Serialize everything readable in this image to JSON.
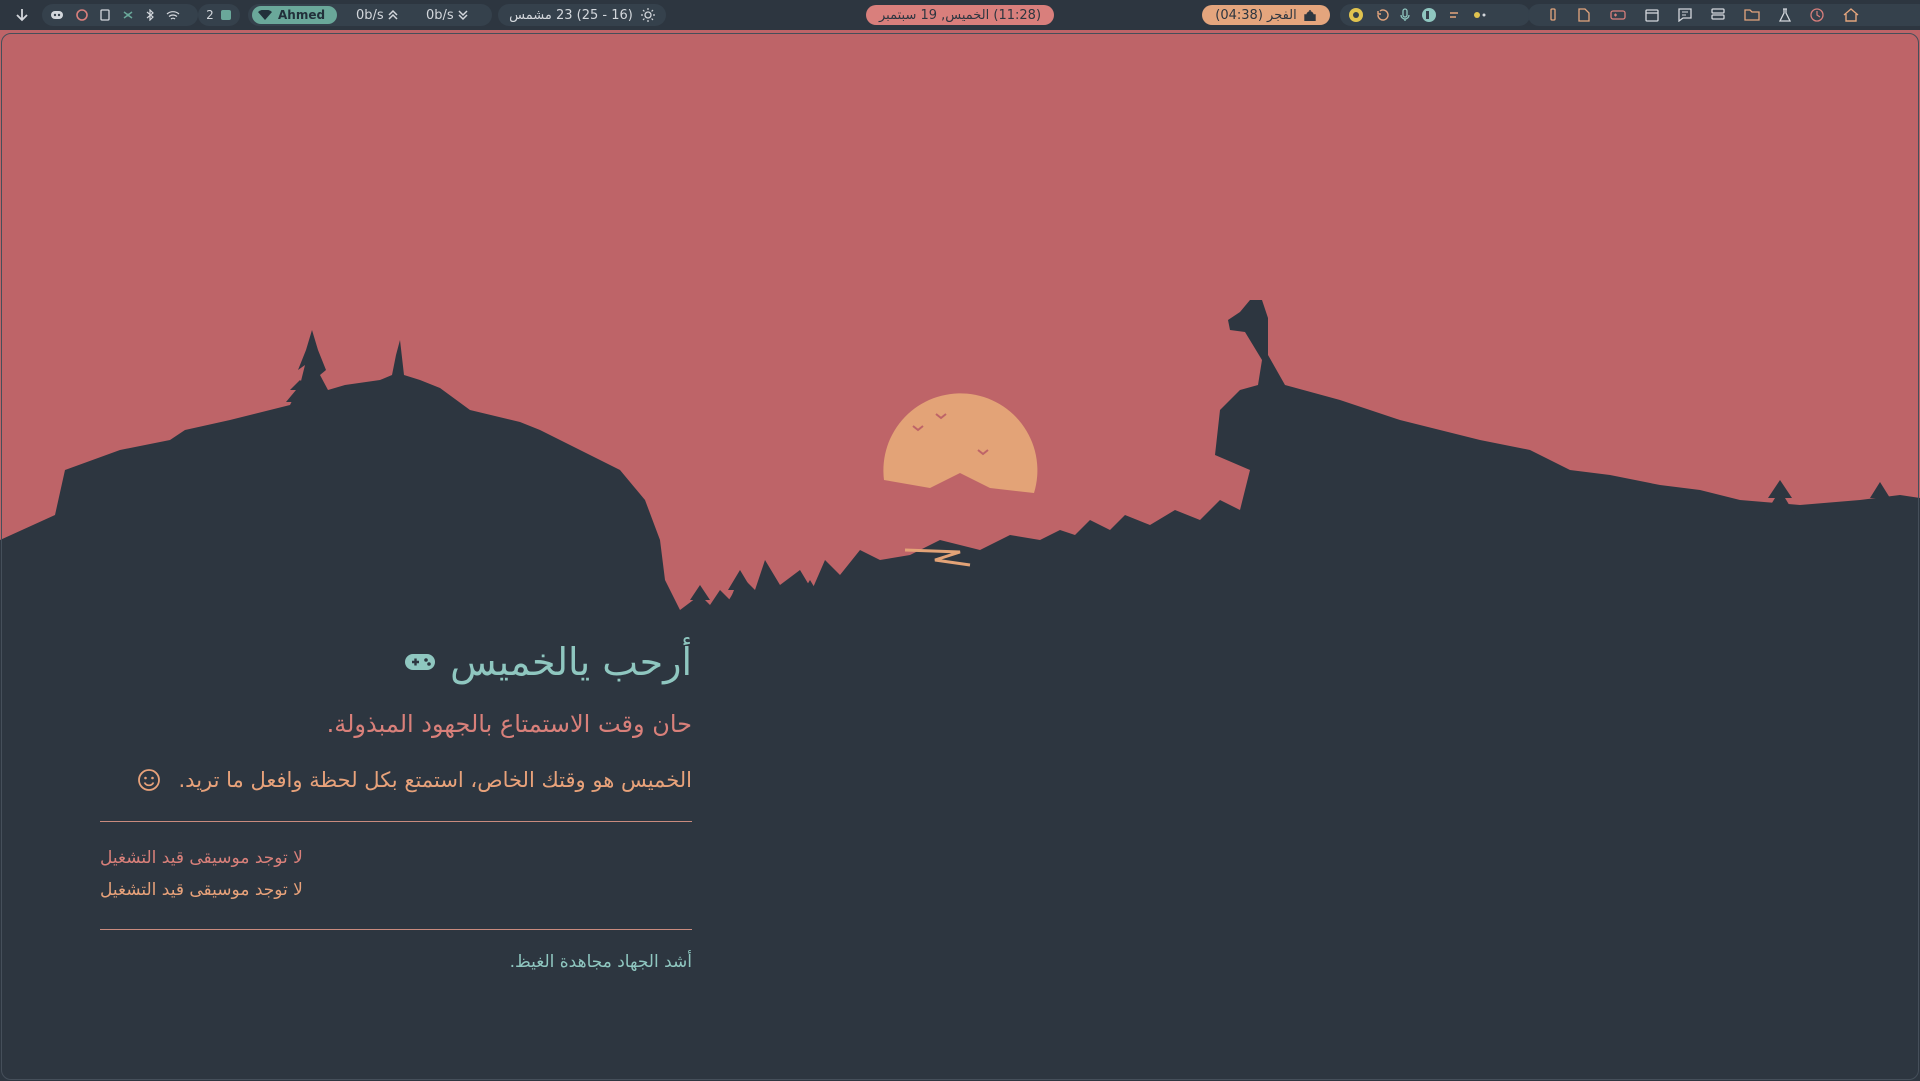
{
  "topbar": {
    "workspace_count": "2",
    "network_name": "Ahmed",
    "upload_speed": "0b/s",
    "download_speed": "0b/s",
    "weather": "(16 - 25) 23 مشمس",
    "datetime": "(11:28) الخميس, 19 سبتمبر",
    "prayer": "الفجر (04:38)",
    "colors": {
      "bar": "#2d3640",
      "segment": "#35414c",
      "green": "#6aa89a",
      "pink": "#d97f7c",
      "orange": "#e4a57d"
    }
  },
  "wallpaper": {
    "sky_color": "#be6468",
    "ground_color": "#2d3640",
    "sun_color": "#e3a377"
  },
  "greeting": {
    "title": "أرحب يالخميس",
    "subtitle": "حان وقت الاستمتاع بالجهود المبذولة.",
    "message": "الخميس هو وقتك الخاص، استمتع بكل لحظة وافعل ما تريد."
  },
  "music": {
    "line1": "لا توجد موسيقى قيد التشغيل",
    "line2": "لا توجد موسيقى قيد التشغيل"
  },
  "quote": "أشد الجهاد مجاهدة الغيظ."
}
